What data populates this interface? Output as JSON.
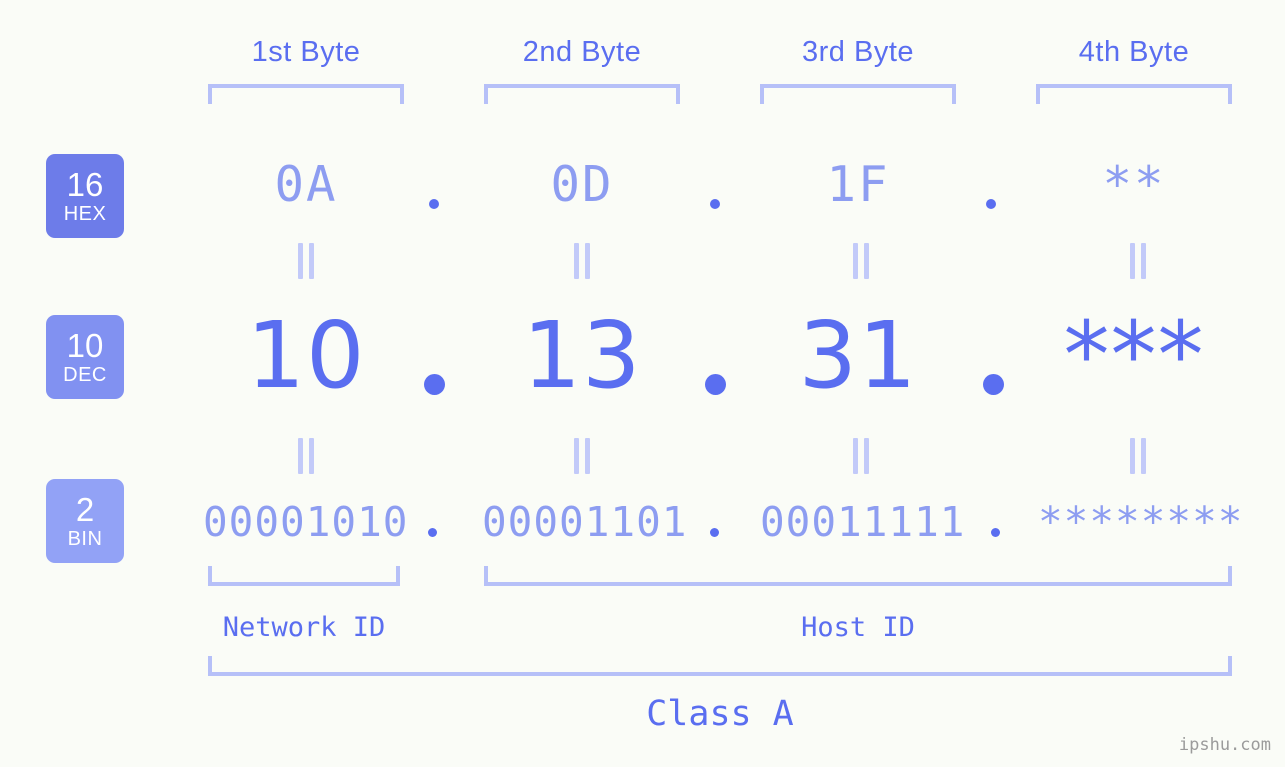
{
  "background_color": "#fafcf7",
  "accent_colors": {
    "strong_blue": "#5a6ef0",
    "light_blue": "#8d9df1",
    "bracket_blue": "#b6c0f8",
    "equals_blue": "#c2caf9",
    "badge_hex": "#6d7ce9",
    "badge_dec": "#8191f1",
    "badge_bin": "#92a2f6",
    "watermark_gray": "#9b9b9b"
  },
  "byte_headers": [
    {
      "label": "1st Byte"
    },
    {
      "label": "2nd Byte"
    },
    {
      "label": "3rd Byte"
    },
    {
      "label": "4th Byte"
    }
  ],
  "radix_badges": [
    {
      "number": "16",
      "system": "HEX"
    },
    {
      "number": "10",
      "system": "DEC"
    },
    {
      "number": "2",
      "system": "BIN"
    }
  ],
  "rows": {
    "hex": {
      "values": [
        "0A",
        "0D",
        "1F",
        "**"
      ],
      "separator": "."
    },
    "dec": {
      "values": [
        "10",
        "13",
        "31",
        "***"
      ],
      "separator": "."
    },
    "bin": {
      "values": [
        "00001010",
        "00001101",
        "00011111",
        "********"
      ],
      "separator": "."
    }
  },
  "equals_symbol": "=",
  "sections": [
    {
      "label": "Network ID"
    },
    {
      "label": "Host ID"
    }
  ],
  "class_label": "Class A",
  "watermark": "ipshu.com"
}
